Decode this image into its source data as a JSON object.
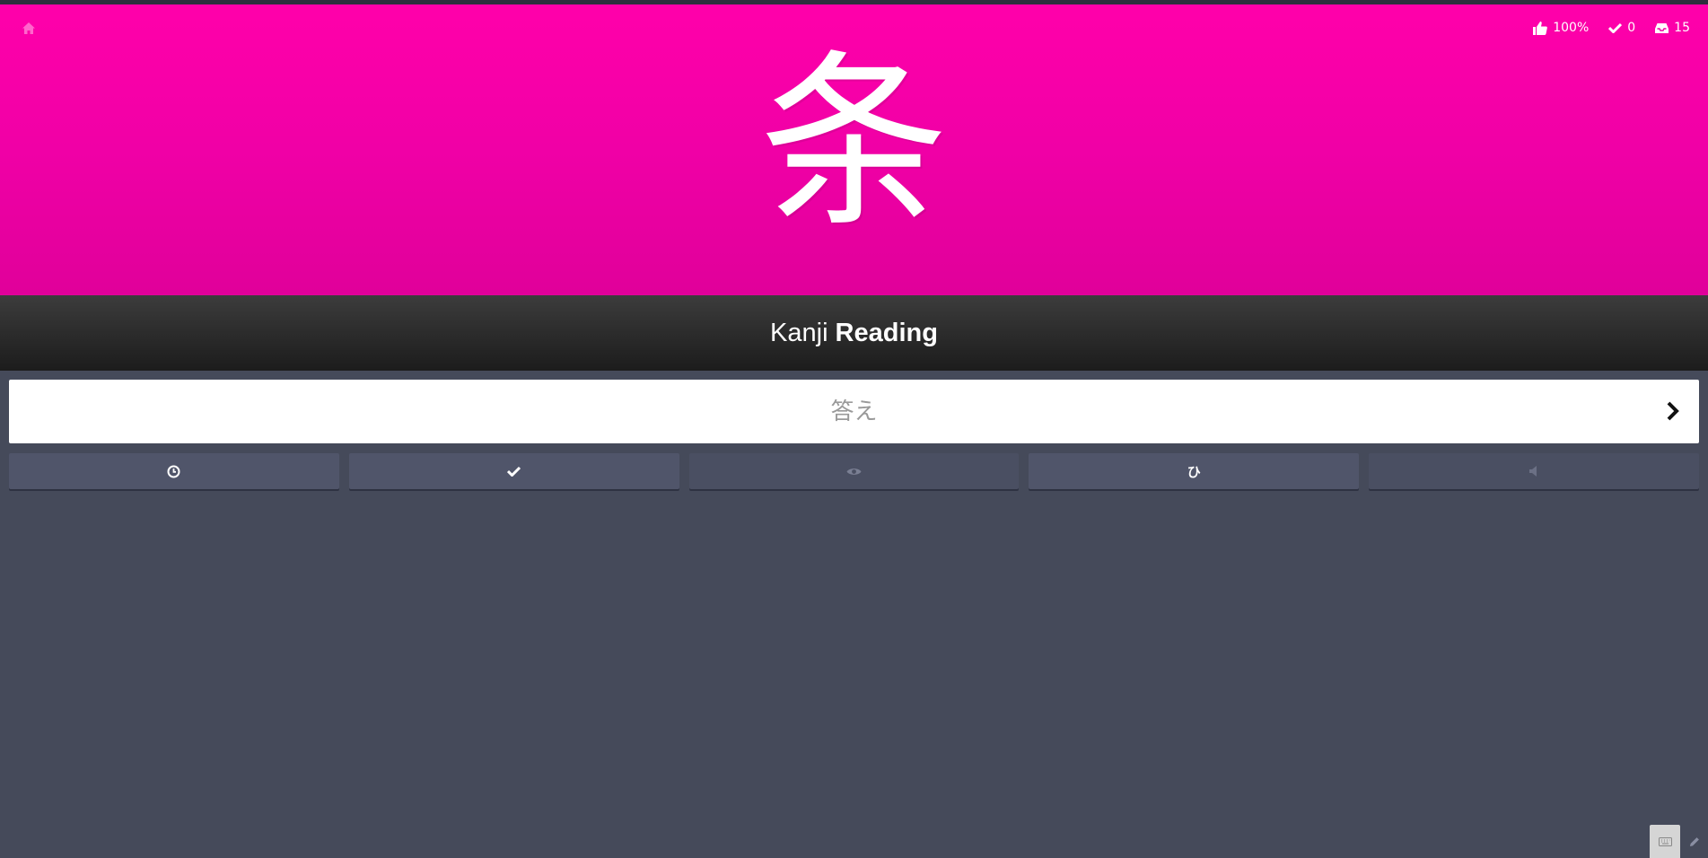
{
  "header": {
    "home_icon": "home-icon",
    "stats": [
      {
        "icon": "thumbs-up-icon",
        "value": "100%"
      },
      {
        "icon": "checkmark-icon",
        "value": "0"
      },
      {
        "icon": "inbox-icon",
        "value": "15"
      }
    ]
  },
  "question": {
    "character": "条",
    "type_word": "Kanji",
    "mode_word": "Reading"
  },
  "answer": {
    "value": "",
    "placeholder": "答え",
    "submit_icon": "chevron-right-icon"
  },
  "actions": [
    {
      "name": "timer-button",
      "icon": "clock-icon"
    },
    {
      "name": "last-items-button",
      "icon": "checkmark-icon"
    },
    {
      "name": "item-info-button",
      "icon": "eye-icon"
    },
    {
      "name": "kana-chart-button",
      "label": "ひ"
    },
    {
      "name": "audio-button",
      "icon": "volume-icon"
    }
  ],
  "footer": {
    "keyboard_icon": "keyboard-icon",
    "edit_icon": "pencil-icon"
  },
  "colors": {
    "kanji_background": "#ff00aa",
    "page_background": "#454a5a",
    "question_bar": "#2a2a2a",
    "button": "#50556a"
  }
}
